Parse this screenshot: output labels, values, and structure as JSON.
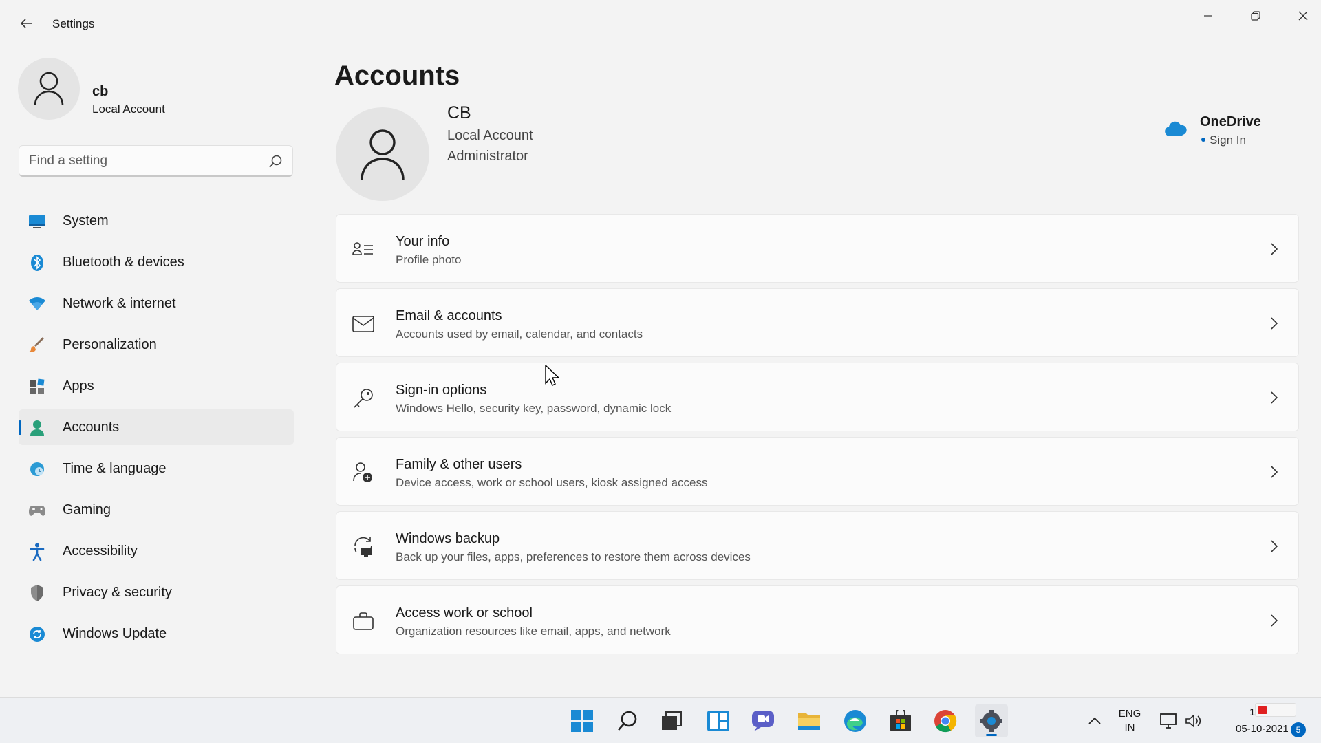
{
  "window": {
    "title": "Settings",
    "controls": {
      "minimize": "minimize-icon",
      "maximize": "restore-icon",
      "close": "close-icon"
    }
  },
  "sidebar": {
    "profile": {
      "name": "cb",
      "type": "Local Account"
    },
    "search": {
      "placeholder": "Find a setting",
      "value": ""
    },
    "items": [
      {
        "label": "System",
        "icon": "system-icon",
        "active": false
      },
      {
        "label": "Bluetooth & devices",
        "icon": "bluetooth-icon",
        "active": false
      },
      {
        "label": "Network & internet",
        "icon": "wifi-icon",
        "active": false
      },
      {
        "label": "Personalization",
        "icon": "brush-icon",
        "active": false
      },
      {
        "label": "Apps",
        "icon": "apps-icon",
        "active": false
      },
      {
        "label": "Accounts",
        "icon": "accounts-icon",
        "active": true
      },
      {
        "label": "Time & language",
        "icon": "globe-clock-icon",
        "active": false
      },
      {
        "label": "Gaming",
        "icon": "gamepad-icon",
        "active": false
      },
      {
        "label": "Accessibility",
        "icon": "accessibility-icon",
        "active": false
      },
      {
        "label": "Privacy & security",
        "icon": "shield-icon",
        "active": false
      },
      {
        "label": "Windows Update",
        "icon": "update-icon",
        "active": false
      }
    ]
  },
  "main": {
    "title": "Accounts",
    "account": {
      "name": "CB",
      "type": "Local Account",
      "role": "Administrator"
    },
    "onedrive": {
      "title": "OneDrive",
      "action": "Sign In"
    },
    "cards": [
      {
        "title": "Your info",
        "subtitle": "Profile photo",
        "icon": "contact-card-icon"
      },
      {
        "title": "Email & accounts",
        "subtitle": "Accounts used by email, calendar, and contacts",
        "icon": "mail-icon"
      },
      {
        "title": "Sign-in options",
        "subtitle": "Windows Hello, security key, password, dynamic lock",
        "icon": "key-icon"
      },
      {
        "title": "Family & other users",
        "subtitle": "Device access, work or school users, kiosk assigned access",
        "icon": "add-person-icon"
      },
      {
        "title": "Windows backup",
        "subtitle": "Back up your files, apps, preferences to restore them across devices",
        "icon": "backup-icon"
      },
      {
        "title": "Access work or school",
        "subtitle": "Organization resources like email, apps, and network",
        "icon": "briefcase-icon"
      }
    ]
  },
  "taskbar": {
    "apps": [
      "start-icon",
      "search-icon",
      "task-view-icon",
      "widgets-icon",
      "chat-icon",
      "file-explorer-icon",
      "edge-icon",
      "store-icon",
      "chrome-icon",
      "settings-icon"
    ],
    "tray": {
      "lang_line1": "ENG",
      "lang_line2": "IN",
      "time": "1",
      "date": "05-10-2021",
      "notifications": "5"
    }
  },
  "colors": {
    "accent": "#0067c0",
    "background": "#f3f3f3",
    "card": "#fbfbfb"
  }
}
